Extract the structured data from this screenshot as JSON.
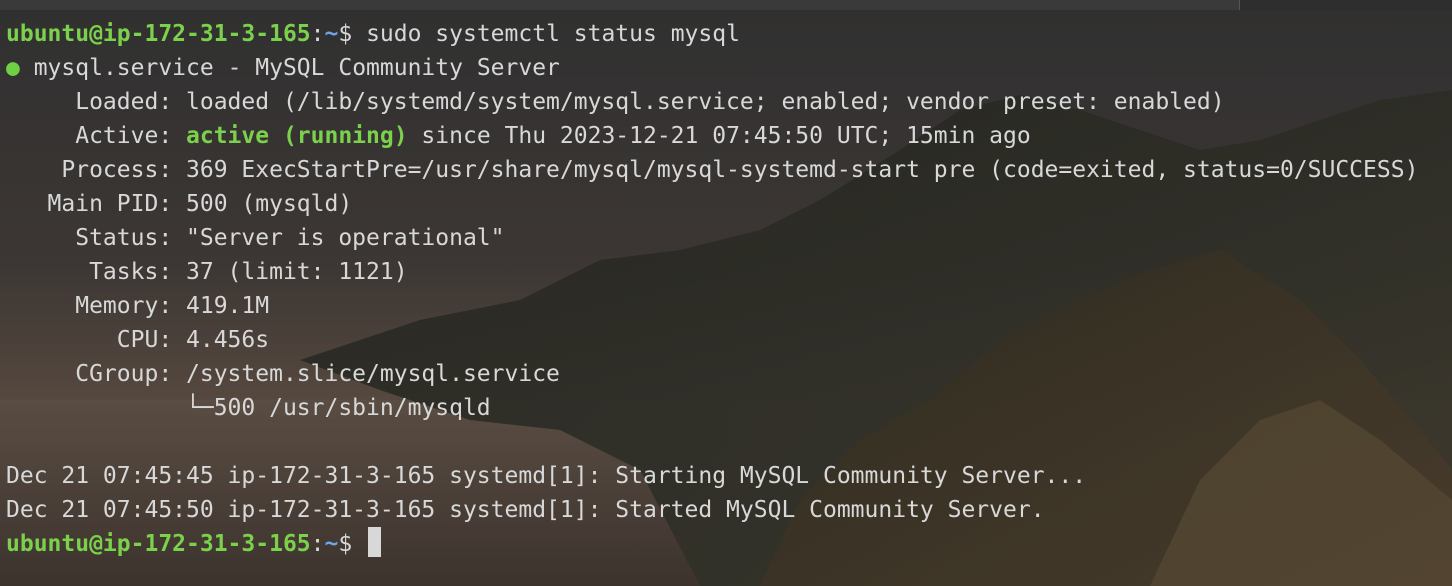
{
  "prompt": {
    "user_host": "ubuntu@ip-172-31-3-165",
    "colon": ":",
    "path": "~",
    "symbol": "$ "
  },
  "command": "sudo systemctl status mysql",
  "service": {
    "dot": "●",
    "header": " mysql.service - MySQL Community Server",
    "loaded_label": "     Loaded: ",
    "loaded_value": "loaded (/lib/systemd/system/mysql.service; enabled; vendor preset: enabled)",
    "active_label": "     Active: ",
    "active_state": "active (running)",
    "active_since": " since Thu 2023-12-21 07:45:50 UTC; 15min ago",
    "process_label": "    Process: ",
    "process_value": "369 ExecStartPre=/usr/share/mysql/mysql-systemd-start pre (code=exited, status=0/SUCCESS)",
    "mainpid_label": "   Main PID: ",
    "mainpid_value": "500 (mysqld)",
    "status_label": "     Status: ",
    "status_value": "\"Server is operational\"",
    "tasks_label": "      Tasks: ",
    "tasks_value": "37 (limit: 1121)",
    "memory_label": "     Memory: ",
    "memory_value": "419.1M",
    "cpu_label": "        CPU: ",
    "cpu_value": "4.456s",
    "cgroup_label": "     CGroup: ",
    "cgroup_value": "/system.slice/mysql.service",
    "cgroup_child": "             └─500 /usr/sbin/mysqld"
  },
  "log": [
    "Dec 21 07:45:45 ip-172-31-3-165 systemd[1]: Starting MySQL Community Server...",
    "Dec 21 07:45:50 ip-172-31-3-165 systemd[1]: Started MySQL Community Server."
  ],
  "colors": {
    "prompt_green": "#7bd14b",
    "path_blue": "#6ea5e6",
    "text": "#d8d8d8"
  }
}
